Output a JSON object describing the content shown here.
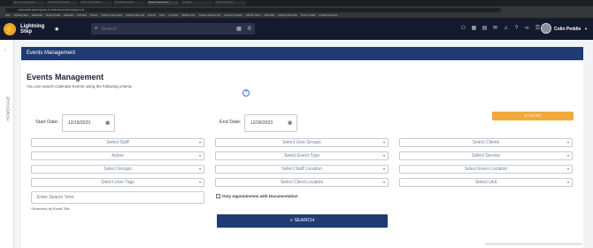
{
  "browser": {
    "tabs": [
      "Action (7) - Lightning Step",
      "Solomon Health & Lightning",
      "(207) LS & Rose (68) | Ke",
      "My Lightning Step Roles",
      "Manage Calendar Events",
      "Timesheets",
      "How to Create Events",
      ""
    ],
    "active_tab_index": 4,
    "url": "colinpeddie.lightningstep.com/client/events/management",
    "bookmarks": [
      "Apps",
      "Lightning Step",
      "Dashboard",
      "Support Portal",
      "Calendars",
      "Hub Spot",
      "Harvest",
      "Lightning Step Interal",
      "Lightning Step Info",
      "Projects",
      "Users",
      "Complete",
      "Sandbox Firm",
      "Solution Services Ops",
      "Contract Template",
      "LSB KPI Home",
      "LSB Deals",
      "Lightning Step Infra",
      "Product Collab",
      "Archived Contracts"
    ]
  },
  "header": {
    "brand": "Lightning Step",
    "logo_letter": "⚡",
    "star": "★",
    "search_icon": "⌕",
    "search_placeholder": "Search",
    "calendar_icon": "▦",
    "phone_icon": "✆",
    "icons": [
      "handshake-icon",
      "calendar-icon",
      "grid-icon",
      "chat-icon",
      "bell-icon",
      "help-icon",
      "link-icon",
      "people-icon"
    ],
    "icon_glyphs": [
      "⚇",
      "▦",
      "▤",
      "✉",
      "♫",
      "?",
      "∞",
      "☰"
    ],
    "user_name": "Colin Peddie",
    "user_caret": "▼"
  },
  "sidebar": {
    "collapse_icon": "‹",
    "label": "HOMEPAGE"
  },
  "page": {
    "breadcrumb": "Events Management",
    "title": "Events Management",
    "subtitle": "You can search Calendar Events using the following criteria:",
    "help_glyph": "?",
    "start_date_label": "Start Date:",
    "start_date_value": "12/19/2023",
    "end_date_label": "End Date:",
    "end_date_value": "12/26/2023",
    "calendar_glyph": "▦",
    "start_button": "⟳ START",
    "filters": [
      [
        "Select Staff",
        "Select User Groups",
        "Select Clients"
      ],
      [
        "Active",
        "Select Event Type",
        "Select Service"
      ],
      [
        "Select Groups",
        "Select Staff Location",
        "Select Event Location"
      ],
      [
        "Select User Tags",
        "Select Client Location",
        "Select Unit"
      ]
    ],
    "caret": "▾",
    "search_term_placeholder": "Enter Search Term",
    "search_term_note": "*Searches by Event Title",
    "only_appointments_label": "Only Appointments with Documentation",
    "search_button": "⌕ SEARCH"
  }
}
